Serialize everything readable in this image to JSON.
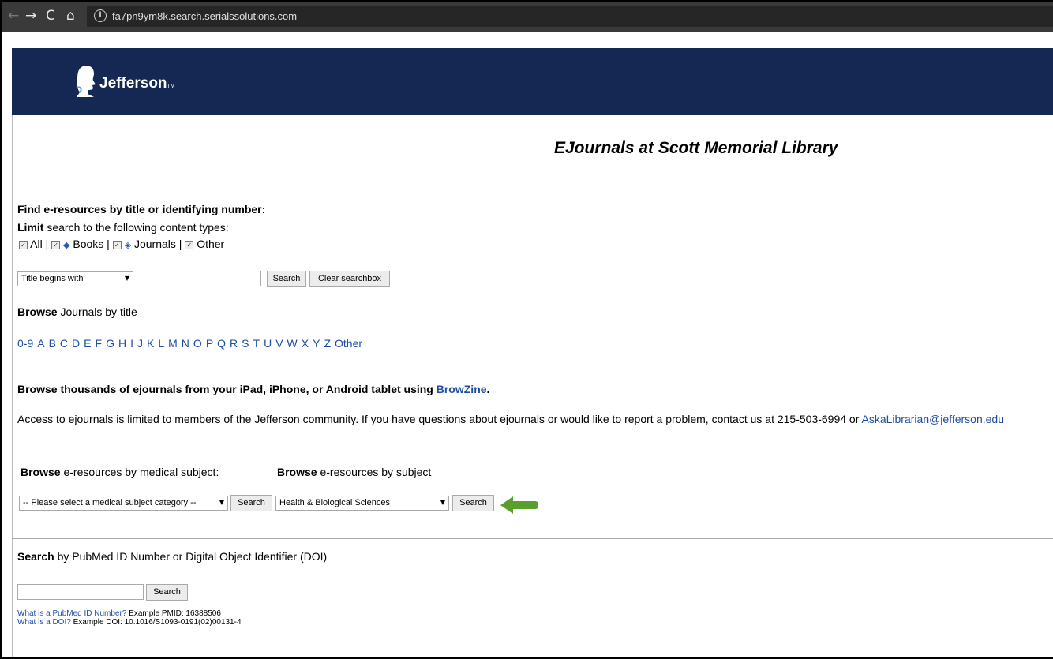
{
  "browser": {
    "url": "fa7pn9ym8k.search.serialssolutions.com"
  },
  "header": {
    "logo_text": "Jefferson",
    "logo_tm": "TM",
    "bg_color": "#152753"
  },
  "page_title": "EJournals at Scott Memorial Library",
  "find": {
    "heading": "Find e-resources by title or identifying number:",
    "limit_bold": "Limit",
    "limit_rest": "search to the following content types:",
    "types": [
      "All",
      "Books",
      "Journals",
      "Other"
    ],
    "select_value": "Title begins with",
    "input_value": "",
    "search_label": "Search",
    "clear_label": "Clear searchbox"
  },
  "browse_title": {
    "bold": "Browse",
    "rest": "Journals by title",
    "letters": [
      "0-9",
      "A",
      "B",
      "C",
      "D",
      "E",
      "F",
      "G",
      "H",
      "I",
      "J",
      "K",
      "L",
      "M",
      "N",
      "O",
      "P",
      "Q",
      "R",
      "S",
      "T",
      "U",
      "V",
      "W",
      "X",
      "Y",
      "Z",
      "Other"
    ]
  },
  "browzine": {
    "text": "Browse thousands of ejournals from your iPad, iPhone, or Android tablet using",
    "link": "BrowZine",
    "end": "."
  },
  "access": {
    "text": "Access to ejournals is limited to members of the Jefferson community. If you have questions about ejournals or would like to report a problem, contact us at 215-503-6994 or",
    "email": "AskaLibrarian@jefferson.edu"
  },
  "medical": {
    "bold": "Browse",
    "rest": "e-resources by medical subject:",
    "select_value": "-- Please select a medical subject category --",
    "search_label": "Search"
  },
  "subject": {
    "bold": "Browse",
    "rest": "e-resources by subject",
    "select_value": "Health & Biological Sciences",
    "search_label": "Search"
  },
  "pubmed": {
    "bold": "Search",
    "rest": "by PubMed ID Number or Digital Object Identifier (DOI)",
    "input_value": "",
    "search_label": "Search",
    "pmid_link": "What is a PubMed ID Number?",
    "pmid_example": "Example PMID: 16388506",
    "doi_link": "What is a DOI?",
    "doi_example": "Example DOI: 10.1016/S1093-0191(02)00131-4"
  },
  "accent_arrow_color": "#5a9e2f"
}
